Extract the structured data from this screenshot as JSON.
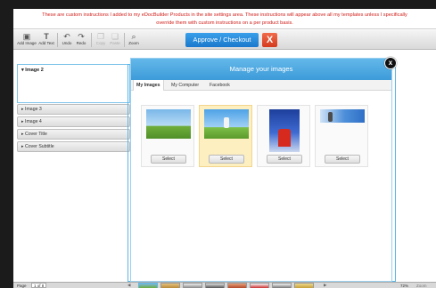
{
  "notice": {
    "line1": "These are custom instructions I added to my eDocBuilder Products in the site settings area. These instructions will appear above all my templates unless I specifically",
    "line2": "override them with custom instructions on a per product basis."
  },
  "toolbar": {
    "add_image": "Add Image",
    "add_text": "Add Text",
    "undo": "Undo",
    "redo": "Redo",
    "copy": "Copy",
    "paste": "Paste",
    "zoom": "Zoom",
    "approve": "Approve / Checkout",
    "close": "X"
  },
  "left_panel": {
    "expanded": "Image 2",
    "items": [
      "Image 3",
      "Image 4",
      "Cover Title",
      "Cover Subtitle"
    ]
  },
  "modal": {
    "title": "Manage your images",
    "tabs": [
      "My Images",
      "My Computer",
      "Facebook"
    ],
    "active_tab": "My Images",
    "select_label": "Select",
    "close": "x"
  },
  "bottom": {
    "page_label": "Page",
    "page_value": "1 of 8",
    "zoom_pct": "72%",
    "zoom_label": "Zoom"
  },
  "colors": {
    "notice_text": "#d0201b",
    "approve": "#1f82d4",
    "close": "#e04a2c",
    "modal_header": "#4aa6e0",
    "selected_card": "#fdefbf"
  }
}
